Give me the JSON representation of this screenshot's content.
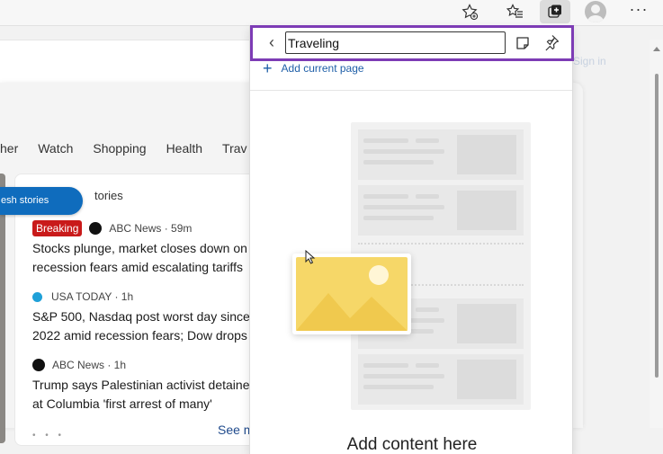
{
  "toolbar": {
    "icons": [
      "favorites-add-icon",
      "favorites-icon",
      "collections-icon",
      "profile-icon",
      "more-icon"
    ],
    "more_label": "···"
  },
  "page": {
    "signin": "Sign in",
    "nav": [
      "her",
      "Watch",
      "Shopping",
      "Health",
      "Trav"
    ],
    "fresh_button": "esh stories",
    "card_title": "tories",
    "news": [
      {
        "badge": "Breaking",
        "source": "ABC News · 59m",
        "headline": [
          "Stocks plunge, market closes down on",
          "recession fears amid escalating tariffs"
        ]
      },
      {
        "source": "USA TODAY · 1h",
        "headline": [
          "S&P 500, Nasdaq post worst day since",
          "2022 amid recession fears; Dow drops"
        ]
      },
      {
        "source": "ABC News · 1h",
        "headline": [
          "Trump says Palestinian activist detaine",
          "at Columbia 'first arrest of many'"
        ]
      }
    ],
    "pager": "• • •",
    "see_more": "See m"
  },
  "collections": {
    "name_value": "Traveling",
    "back_label": "‹",
    "add_current_page": "Add current page",
    "add_content": "Add content here"
  },
  "colors": {
    "accent": "#0f6cbd",
    "highlight_border": "#7d3cb5",
    "breaking": "#c91a1a",
    "illustration_yellow": "#f6d768"
  }
}
